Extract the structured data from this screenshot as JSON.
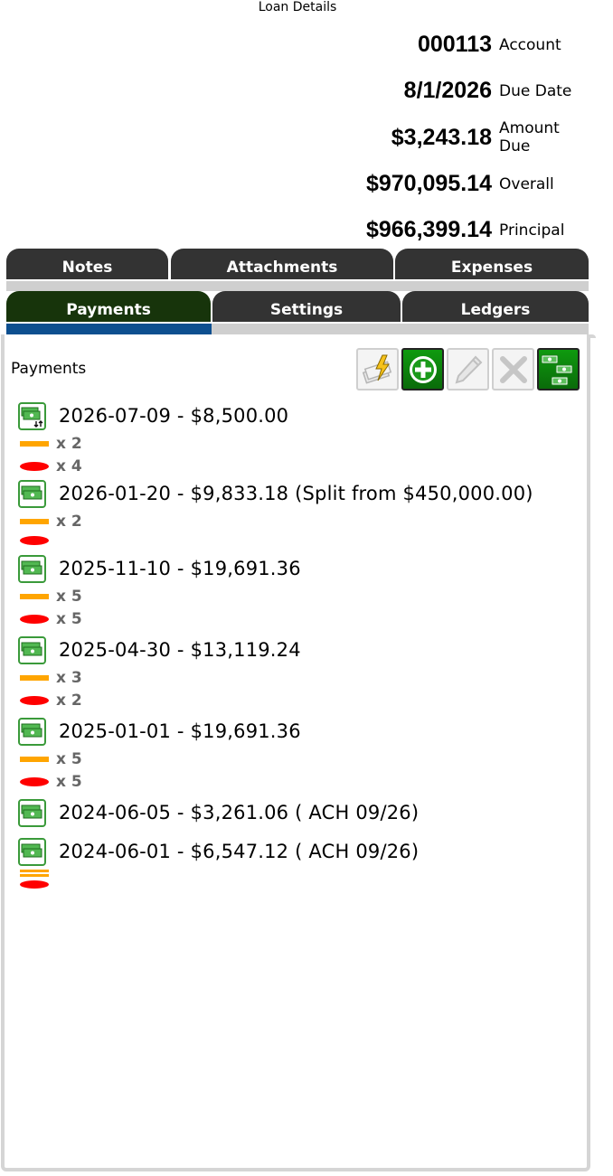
{
  "title": "Loan Details",
  "summary": [
    {
      "value": "000113",
      "label": "Account"
    },
    {
      "value": "8/1/2026",
      "label": "Due Date"
    },
    {
      "value": "$3,243.18",
      "label": "Amount Due"
    },
    {
      "value": "$970,095.14",
      "label": "Overall"
    },
    {
      "value": "$966,399.14",
      "label": "Principal"
    }
  ],
  "tabs_row1": [
    "Notes",
    "Attachments",
    "Expenses"
  ],
  "tabs_row2": [
    "Payments",
    "Settings",
    "Ledgers"
  ],
  "active_tab": "Payments",
  "panel_label": "Payments",
  "toolbar": [
    {
      "name": "auto-pay-icon",
      "state": "disabled"
    },
    {
      "name": "add-icon",
      "state": "enabled"
    },
    {
      "name": "edit-icon",
      "state": "disabled"
    },
    {
      "name": "delete-icon",
      "state": "disabled"
    },
    {
      "name": "money-stack-icon",
      "state": "enabled"
    }
  ],
  "colors": {
    "tab": "#333333",
    "active_tab": "#17340b",
    "active_underline": "#0d4f8f",
    "orange_marker": "#ffa500",
    "red_marker": "#ff0000",
    "count_text": "#666666"
  },
  "payments": [
    {
      "text": "2026-07-09 - $8,500.00",
      "icon": "money-transfer-icon",
      "orange_count": "x 2",
      "red_count": "x 4"
    },
    {
      "text": "2026-01-20 - $9,833.18 (Split from $450,000.00)",
      "icon": "money-icon",
      "orange_count": "x 2",
      "red_count": ""
    },
    {
      "text": "2025-11-10 - $19,691.36",
      "icon": "money-icon",
      "orange_count": "x 5",
      "red_count": "x 5"
    },
    {
      "text": "2025-04-30 - $13,119.24",
      "icon": "money-icon",
      "orange_count": "x 3",
      "red_count": "x 2"
    },
    {
      "text": "2025-01-01 - $19,691.36",
      "icon": "money-icon",
      "orange_count": "x 5",
      "red_count": "x 5"
    },
    {
      "text": "2024-06-05 - $3,261.06 ( ACH 09/26)",
      "icon": "money-icon"
    },
    {
      "text": "2024-06-01 - $6,547.12 ( ACH 09/26)",
      "icon": "money-icon",
      "stacked_marks": true
    }
  ]
}
